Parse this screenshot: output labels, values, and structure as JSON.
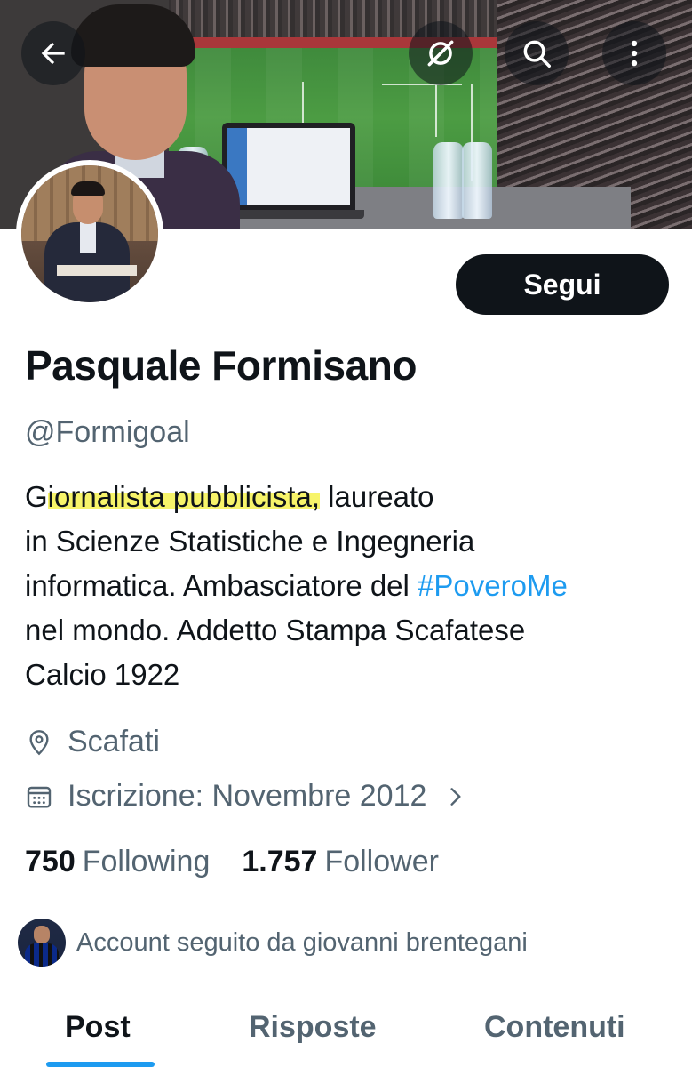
{
  "header": {
    "back_icon": "arrow-left-icon",
    "grok_icon": "grok-icon",
    "search_icon": "search-icon",
    "more_icon": "more-vertical-icon"
  },
  "profile": {
    "follow_label": "Segui",
    "name": "Pasquale Formisano",
    "handle": "@Formigoal",
    "bio": {
      "line1_prefix": "G",
      "line1_highlight": "iornalista pubblicista,",
      "line1_suffix": " laureato",
      "line2": "in Scienze Statistiche e Ingegneria",
      "line3_text": "informatica. Ambasciatore del ",
      "line3_hashtag": "#PoveroMe",
      "line4": "nel mondo. Addetto Stampa Scafatese",
      "line5": "Calcio 1922"
    },
    "location": "Scafati",
    "joined": "Iscrizione: Novembre 2012",
    "following_count": "750",
    "following_label": "Following",
    "followers_count": "1.757",
    "followers_label": "Follower",
    "followed_by": "Account seguito da giovanni brentegani"
  },
  "tabs": [
    {
      "label": "Post",
      "active": true
    },
    {
      "label": "Risposte",
      "active": false
    },
    {
      "label": "Contenuti",
      "active": false
    }
  ],
  "colors": {
    "accent": "#1d9bf0",
    "text_primary": "#0f1419",
    "text_secondary": "#536471",
    "highlight": "#f7f46a"
  }
}
